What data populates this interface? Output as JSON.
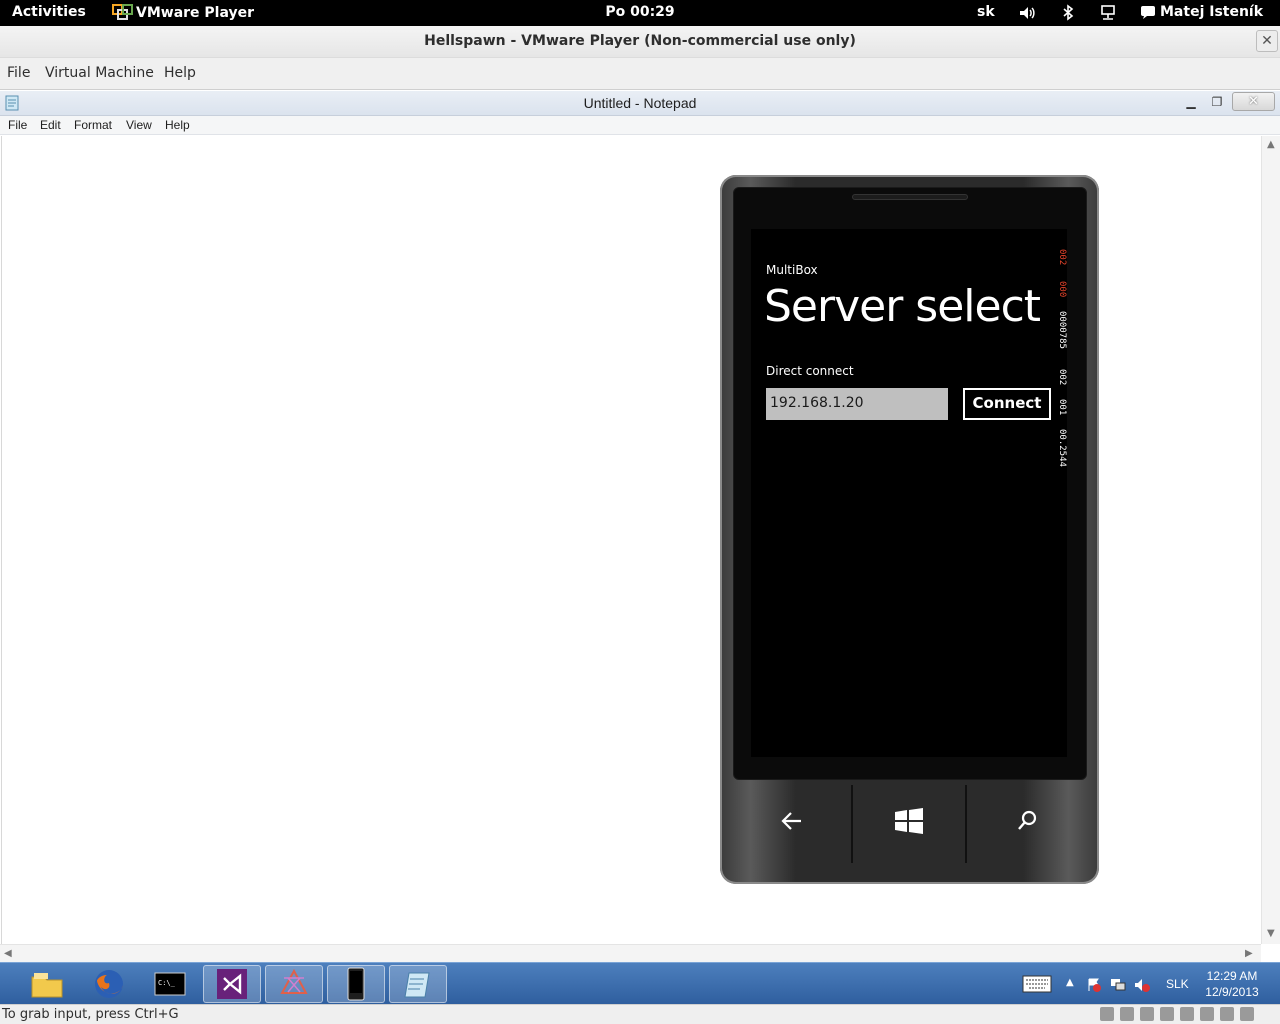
{
  "topbar": {
    "activities": "Activities",
    "app_name": "VMware Player",
    "clock": "Po 00:29",
    "language": "sk",
    "user": "Matej Isteník"
  },
  "vmware": {
    "title": "Hellspawn - VMware Player (Non-commercial use only)",
    "menu": [
      "File",
      "Virtual Machine",
      "Help"
    ],
    "status_message": "To grab input, press Ctrl+G"
  },
  "notepad": {
    "title": "Untitled - Notepad",
    "menu": [
      "File",
      "Edit",
      "Format",
      "View",
      "Help"
    ],
    "content": ""
  },
  "phone_app": {
    "app_name": "MultiBox",
    "page_title": "Server select",
    "direct_connect_label": "Direct connect",
    "ip_value": "192.168.1.20",
    "connect_label": "Connect",
    "frame_counters": [
      "002",
      "000",
      "0000785",
      "002",
      "001",
      "00.2544"
    ]
  },
  "taskbar": {
    "apps": [
      "file-explorer",
      "firefox",
      "command-prompt",
      "visual-studio",
      "xaml-app",
      "windows-phone-emulator",
      "notepad"
    ],
    "language": "SLK",
    "time": "12:29 AM",
    "date": "12/9/2013"
  },
  "colors": {
    "phone_counter_accent": "#e8452c",
    "taskbar_blue": "#2f5f9f"
  }
}
